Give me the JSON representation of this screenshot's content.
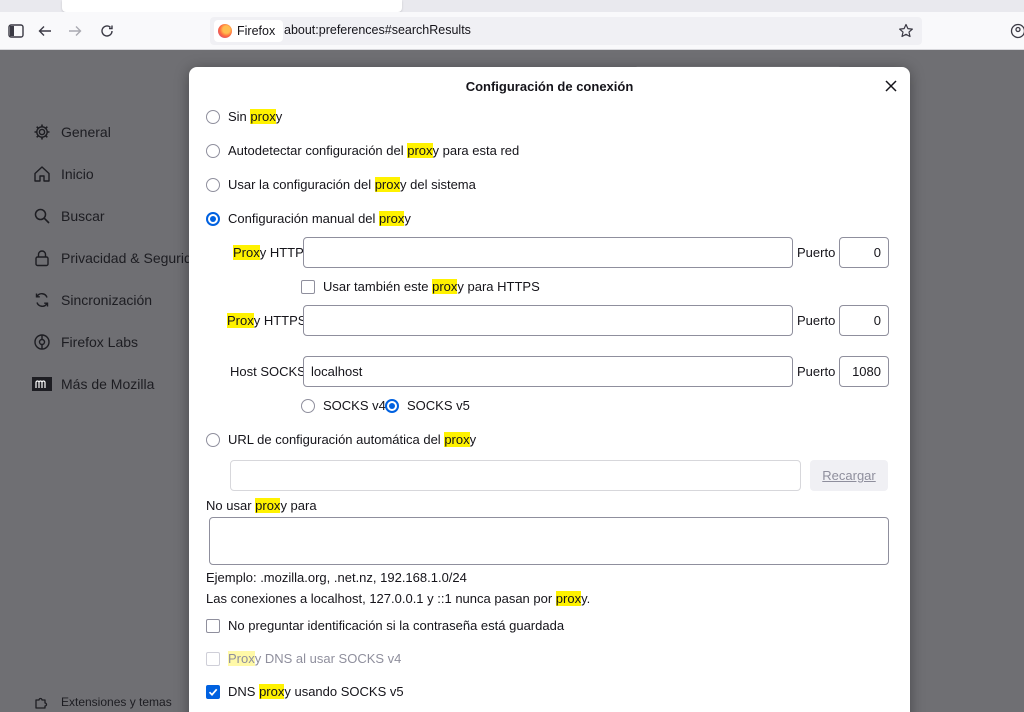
{
  "browser": {
    "identity_label": "Firefox",
    "url": "about:preferences#searchResults"
  },
  "sidebar": {
    "items": [
      {
        "label": "General",
        "icon": "gear-icon"
      },
      {
        "label": "Inicio",
        "icon": "home-icon"
      },
      {
        "label": "Buscar",
        "icon": "search-icon"
      },
      {
        "label": "Privacidad & Seguridad",
        "icon": "lock-icon"
      },
      {
        "label": "Sincronización",
        "icon": "sync-icon"
      },
      {
        "label": "Firefox Labs",
        "icon": "labs-icon"
      },
      {
        "label": "Más de Mozilla",
        "icon": "mozilla-icon"
      }
    ],
    "extensions_label": "Extensiones y temas"
  },
  "dialog": {
    "title": "Configuración de conexión",
    "options": {
      "no_proxy": {
        "pre": "Sin ",
        "hl": "prox",
        "post": "y"
      },
      "autodetect": {
        "pre": "Autodetectar configuración del ",
        "hl": "prox",
        "post": "y para esta red"
      },
      "system": {
        "pre": "Usar la configuración del ",
        "hl": "prox",
        "post": "y del sistema"
      },
      "manual": {
        "pre": "Configuración manual del ",
        "hl": "prox",
        "post": "y",
        "selected": true
      },
      "pac": {
        "pre": "URL de configuración automática del ",
        "hl": "prox",
        "post": "y"
      }
    },
    "http_proxy": {
      "label_hl": "Prox",
      "label_post": "y HTTP",
      "value": "",
      "port_label": "Puerto",
      "port": "0"
    },
    "also_https": {
      "pre": "Usar también este ",
      "hl": "prox",
      "post": "y para HTTPS",
      "checked": false
    },
    "https_proxy": {
      "label_hl": "Prox",
      "label_post": "y HTTPS",
      "value": "",
      "port_label": "Puerto",
      "port": "0"
    },
    "socks": {
      "label": "Host SOCKS",
      "value": "localhost",
      "port_label": "Puerto",
      "port": "1080",
      "v4_label": "SOCKS v4",
      "v5_label": "SOCKS v5",
      "selected": "v5"
    },
    "pac_url": {
      "value": "",
      "reload_label": "Recargar"
    },
    "no_proxy_for": {
      "pre": "No usar ",
      "hl": "prox",
      "post": "y para",
      "value": ""
    },
    "example": "Ejemplo: .mozilla.org, .net.nz, 192.168.1.0/24",
    "localhost_note": {
      "pre": "Las conexiones a localhost, 127.0.0.1 y ::1 nunca pasan por ",
      "hl": "prox",
      "post": "y."
    },
    "no_auth_prompt": {
      "label": "No preguntar identificación si la contraseña está guardada",
      "checked": false
    },
    "dns_socks4": {
      "hl": "Prox",
      "post": "y DNS al usar SOCKS v4",
      "checked": false,
      "disabled": true
    },
    "dns_socks5": {
      "pre": "DNS ",
      "hl": "prox",
      "post": "y usando SOCKS v5",
      "checked": true
    }
  }
}
